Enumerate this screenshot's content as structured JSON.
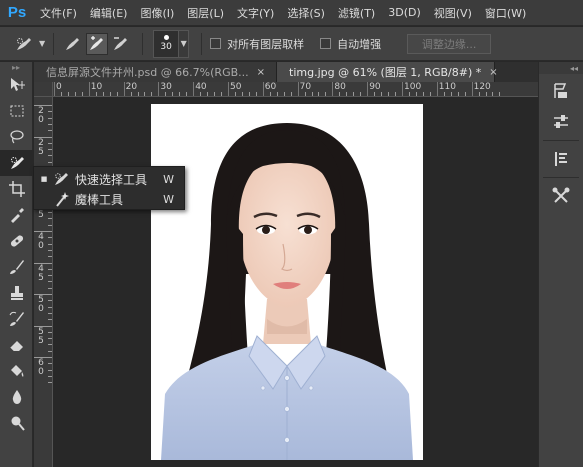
{
  "app": {
    "logo": "Ps"
  },
  "menu": [
    "文件(F)",
    "编辑(E)",
    "图像(I)",
    "图层(L)",
    "文字(Y)",
    "选择(S)",
    "滤镜(T)",
    "3D(D)",
    "视图(V)",
    "窗口(W)"
  ],
  "options": {
    "brush_size": "30",
    "sample_all_layers": "对所有图层取样",
    "auto_enhance": "自动增强",
    "refine_edge": "调整边缘..."
  },
  "tabs": [
    {
      "label": "信息屏源文件并州.psd @ 66.7%(RGB...",
      "close": "×"
    },
    {
      "label": "timg.jpg @ 61% (图层 1, RGB/8#) *",
      "close": "×"
    }
  ],
  "ruler": {
    "h_labels": [
      "0",
      "10",
      "20",
      "30",
      "40",
      "50",
      "60",
      "70",
      "80",
      "90",
      "100",
      "110",
      "120"
    ],
    "v_labels": [
      [
        "1",
        "0"
      ],
      [
        "1",
        "5"
      ],
      [
        "2",
        "0"
      ],
      [
        "2",
        "5"
      ],
      [
        "3",
        "0"
      ],
      [
        "3",
        "5"
      ],
      [
        "4",
        "0"
      ],
      [
        "4",
        "5"
      ],
      [
        "5",
        "0"
      ],
      [
        "5",
        "5"
      ],
      [
        "6",
        "0"
      ]
    ]
  },
  "flyout": {
    "items": [
      {
        "label": "快速选择工具",
        "key": "W",
        "active_marker": "■",
        "icon": "quick-selection-icon"
      },
      {
        "label": "魔棒工具",
        "key": "W",
        "active_marker": "",
        "icon": "magic-wand-icon"
      }
    ]
  },
  "colors": {
    "background": "#282828",
    "panel": "#424242",
    "menubar": "#3c3c3c",
    "accent": "#31a8ff",
    "shirt": "#b5c5e3",
    "hair": "#1c1716",
    "skin": "#f3d6c8"
  }
}
